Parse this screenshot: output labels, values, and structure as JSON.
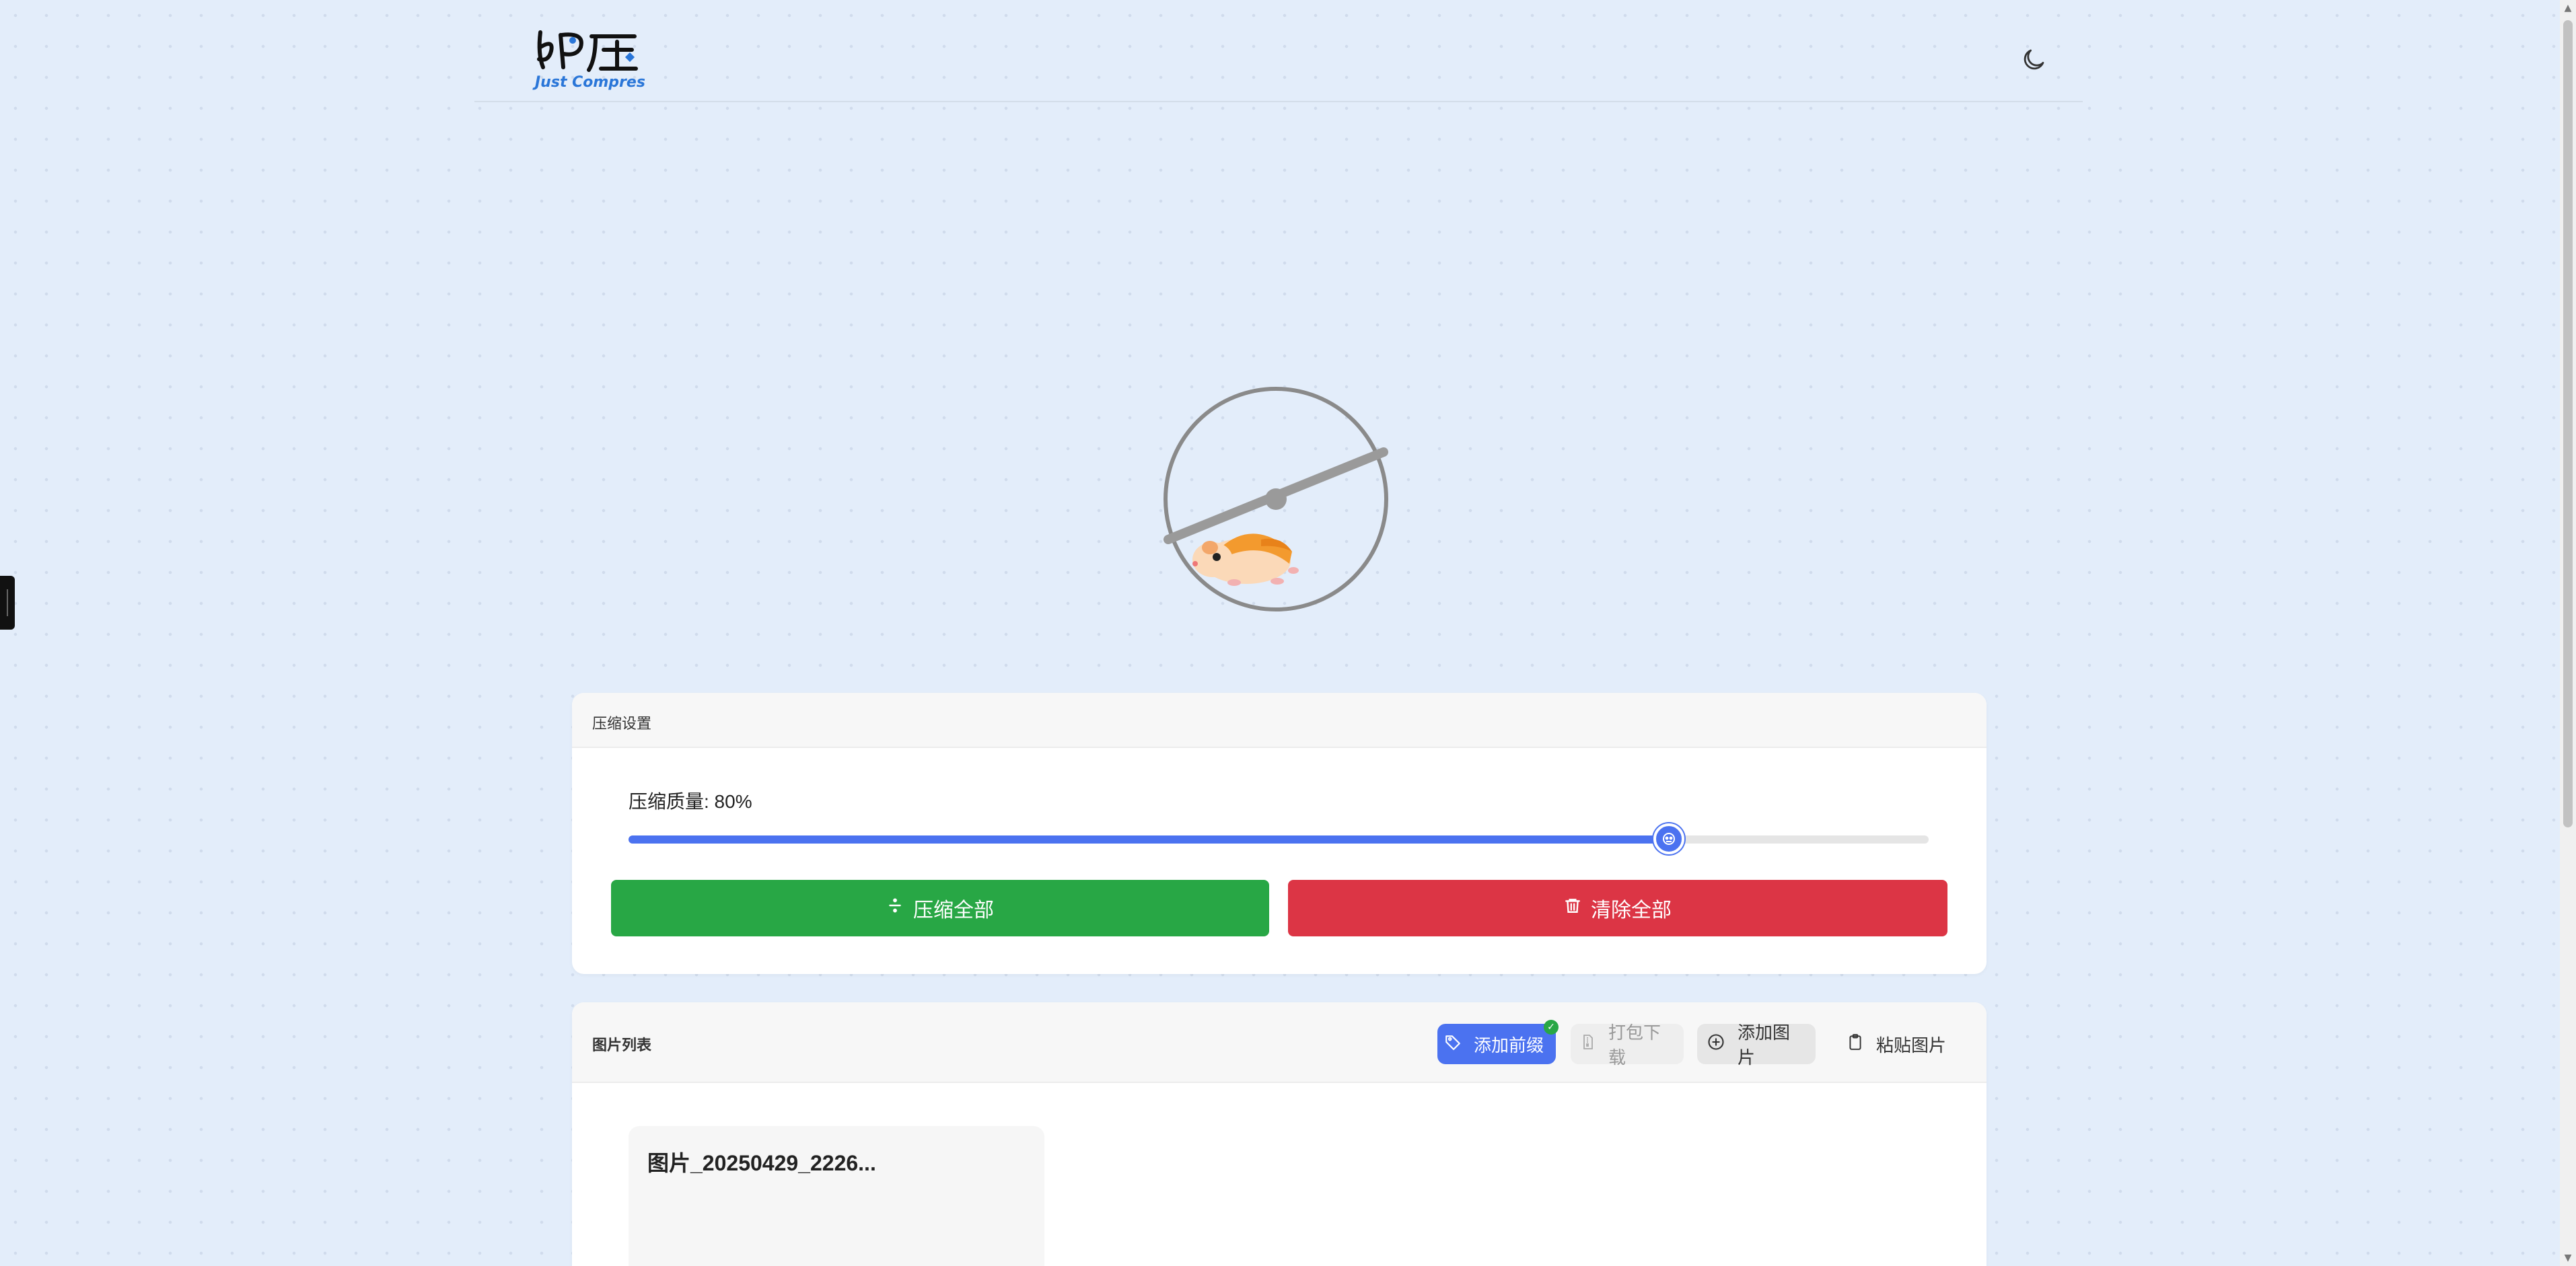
{
  "header": {
    "logo_text": "Just Compres",
    "theme_icon": "moon-icon"
  },
  "settings": {
    "title": "压缩设置",
    "quality_label": "压缩质量: 80%",
    "quality": 0.8,
    "compress_all_label": "压缩全部",
    "clear_all_label": "清除全部",
    "colors": {
      "accent": "#4b72f0",
      "green": "#28a745",
      "red": "#dc3545"
    }
  },
  "list": {
    "title": "图片列表",
    "tools": {
      "add_prefix": "添加前缀",
      "pack_download": "打包下载",
      "add_image": "添加图片",
      "paste_image": "粘贴图片"
    },
    "items": [
      {
        "name": "图片_20250429_2226..."
      }
    ]
  }
}
